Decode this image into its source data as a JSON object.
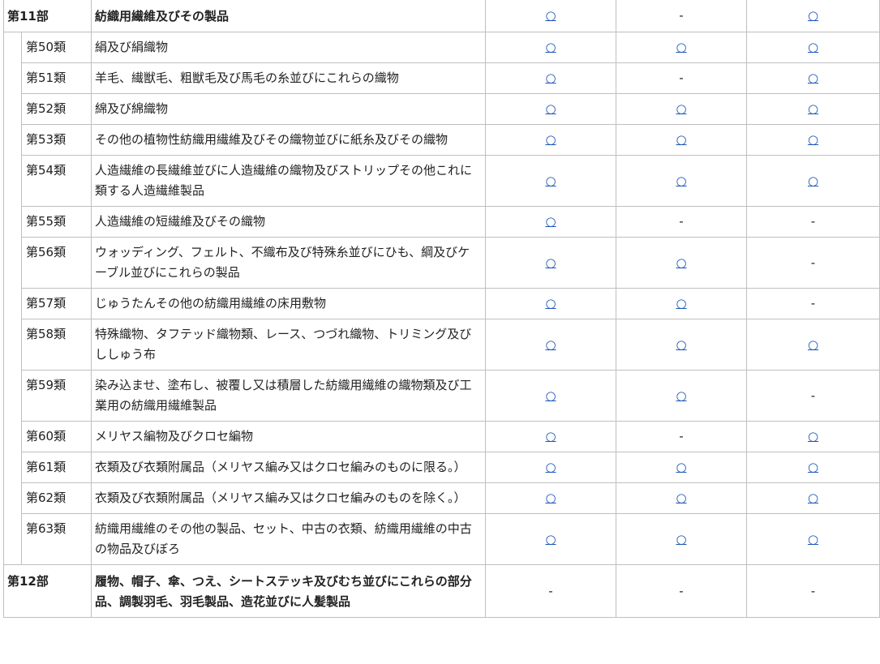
{
  "symbols": {
    "available": "○",
    "unavailable": "-"
  },
  "sections": [
    {
      "code": "第11部",
      "description": "紡織用繊維及びその製品",
      "marks": [
        "available",
        "unavailable",
        "available"
      ],
      "chapters": [
        {
          "code": "第50類",
          "description": "絹及び絹織物",
          "marks": [
            "available",
            "available",
            "available"
          ]
        },
        {
          "code": "第51類",
          "description": "羊毛、繊獣毛、粗獣毛及び馬毛の糸並びにこれらの織物",
          "marks": [
            "available",
            "unavailable",
            "available"
          ]
        },
        {
          "code": "第52類",
          "description": "綿及び綿織物",
          "marks": [
            "available",
            "available",
            "available"
          ]
        },
        {
          "code": "第53類",
          "description": "その他の植物性紡織用繊維及びその織物並びに紙糸及びその織物",
          "marks": [
            "available",
            "available",
            "available"
          ]
        },
        {
          "code": "第54類",
          "description": "人造繊維の長繊維並びに人造繊維の織物及びストリップその他これに類する人造繊維製品",
          "marks": [
            "available",
            "available",
            "available"
          ]
        },
        {
          "code": "第55類",
          "description": "人造繊維の短繊維及びその織物",
          "marks": [
            "available",
            "unavailable",
            "unavailable"
          ]
        },
        {
          "code": "第56類",
          "description": "ウォッディング、フェルト、不織布及び特殊糸並びにひも、綱及びケーブル並びにこれらの製品",
          "marks": [
            "available",
            "available",
            "unavailable"
          ]
        },
        {
          "code": "第57類",
          "description": "じゅうたんその他の紡織用繊維の床用敷物",
          "marks": [
            "available",
            "available",
            "unavailable"
          ]
        },
        {
          "code": "第58類",
          "description": "特殊織物、タフテッド織物類、レース、つづれ織物、トリミング及びししゅう布",
          "marks": [
            "available",
            "available",
            "available"
          ]
        },
        {
          "code": "第59類",
          "description": "染み込ませ、塗布し、被覆し又は積層した紡織用繊維の織物類及び工業用の紡織用繊維製品",
          "marks": [
            "available",
            "available",
            "unavailable"
          ]
        },
        {
          "code": "第60類",
          "description": "メリヤス編物及びクロセ編物",
          "marks": [
            "available",
            "unavailable",
            "available"
          ]
        },
        {
          "code": "第61類",
          "description": "衣類及び衣類附属品（メリヤス編み又はクロセ編みのものに限る。）",
          "marks": [
            "available",
            "available",
            "available"
          ]
        },
        {
          "code": "第62類",
          "description": "衣類及び衣類附属品（メリヤス編み又はクロセ編みのものを除く。）",
          "marks": [
            "available",
            "available",
            "available"
          ]
        },
        {
          "code": "第63類",
          "description": "紡織用繊維のその他の製品、セット、中古の衣類、紡織用繊維の中古の物品及びぼろ",
          "marks": [
            "available",
            "available",
            "available"
          ]
        }
      ]
    },
    {
      "code": "第12部",
      "description": "履物、帽子、傘、つえ、シートステッキ及びむち並びにこれらの部分品、調製羽毛、羽毛製品、造花並びに人髪製品",
      "marks": [
        "unavailable",
        "unavailable",
        "unavailable"
      ],
      "chapters": []
    }
  ]
}
